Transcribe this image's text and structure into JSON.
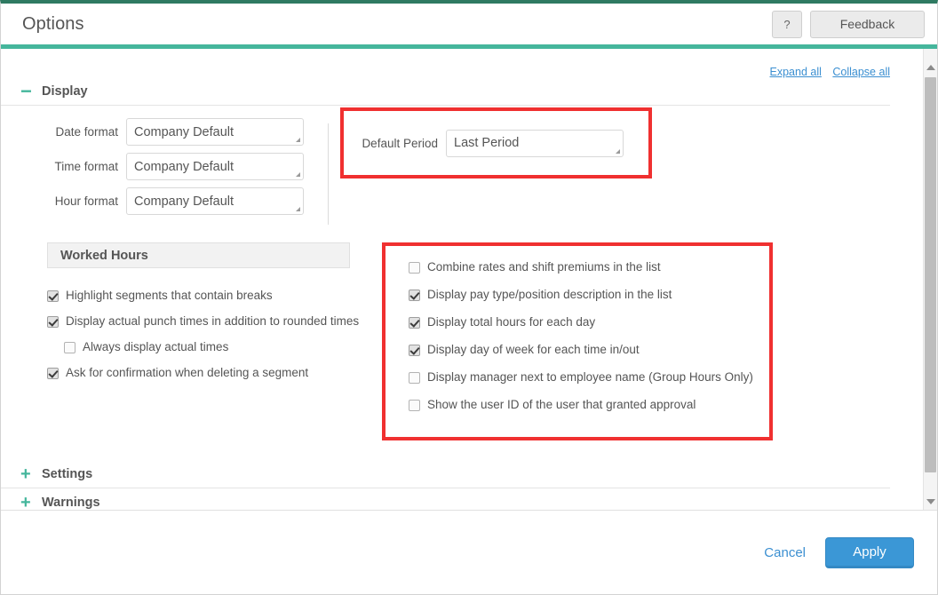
{
  "header": {
    "title": "Options",
    "help_label": "?",
    "feedback_label": "Feedback"
  },
  "toolbar": {
    "expand_all": "Expand all",
    "collapse_all": "Collapse all"
  },
  "sections": [
    {
      "title": "Display",
      "toggle": "−"
    },
    {
      "title": "Settings",
      "toggle": "+"
    },
    {
      "title": "Warnings",
      "toggle": "+"
    },
    {
      "title": "",
      "toggle": "−"
    }
  ],
  "display": {
    "fields": [
      {
        "label": "Date format",
        "value": "Company Default"
      },
      {
        "label": "Time format",
        "value": "Company Default"
      },
      {
        "label": "Hour format",
        "value": "Company Default"
      }
    ],
    "default_period": {
      "label": "Default Period",
      "value": "Last Period"
    },
    "worked_hours_header": "Worked Hours",
    "left_checkboxes": [
      {
        "label": "Highlight segments that contain breaks",
        "checked": true,
        "indent": false
      },
      {
        "label": "Display actual punch times in addition to rounded times",
        "checked": true,
        "indent": false
      },
      {
        "label": "Always display actual times",
        "checked": false,
        "indent": true
      },
      {
        "label": "Ask for confirmation when deleting a segment",
        "checked": true,
        "indent": false
      }
    ],
    "right_checkboxes": [
      {
        "label": "Combine rates and shift premiums in the list",
        "checked": false
      },
      {
        "label": "Display pay type/position description in the list",
        "checked": true
      },
      {
        "label": "Display total hours for each day",
        "checked": true
      },
      {
        "label": "Display day of week for each time in/out",
        "checked": true
      },
      {
        "label": "Display manager next to employee name (Group Hours Only)",
        "checked": false
      },
      {
        "label": "Show the user ID of the user that granted approval",
        "checked": false
      }
    ]
  },
  "footer": {
    "cancel_label": "Cancel",
    "apply_label": "Apply"
  },
  "colors": {
    "accent_green": "#45b69c",
    "top_border": "#2f7a62",
    "primary_blue": "#3b97d6",
    "link_blue": "#3b8fd1",
    "highlight_red": "#f03030"
  }
}
